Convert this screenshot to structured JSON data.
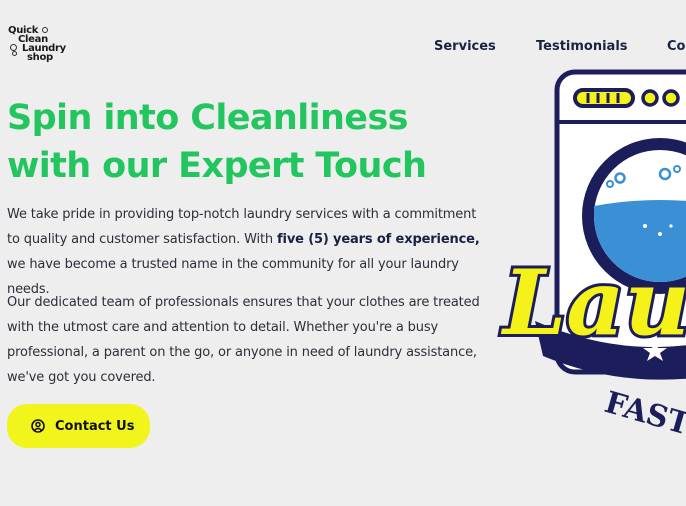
{
  "header": {
    "logo": {
      "lines": [
        "Quick",
        "Clean",
        "Laundry",
        "shop"
      ]
    },
    "nav": [
      "Services",
      "Testimonials",
      "Co"
    ]
  },
  "hero": {
    "title_line1": "Spin into Cleanliness",
    "title_line2": "with our Expert Touch",
    "para1_a": "We take pride in providing top-notch laundry services with a commitment to quality and customer satisfaction. With ",
    "para1_bold": "five (5) years of experience,",
    "para1_b": " we have become a trusted name in the community for all your laundry needs.",
    "para2": "Our dedicated team of professionals ensures that your clothes are treated with the utmost care and attention to detail. Whether you're a busy professional, a parent on the go, or anyone in need of laundry assistance, we've got you covered.",
    "cta_label": "Contact Us",
    "cta_icon": "user-circle-icon"
  },
  "graphic": {
    "script_text": "Lau",
    "arc_text": "FAST",
    "colors": {
      "navy": "#1c1e5c",
      "yellow": "#f5f21a",
      "water": "#3b8fd4",
      "green": "#22c55e"
    }
  }
}
